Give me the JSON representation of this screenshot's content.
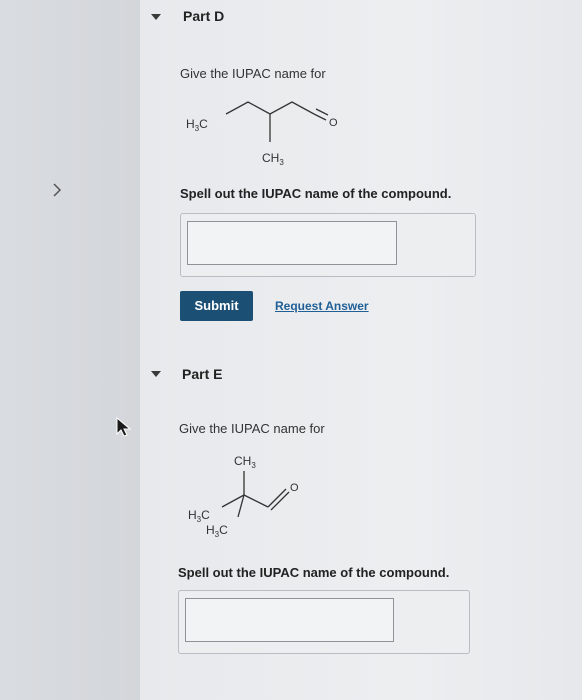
{
  "partD": {
    "title": "Part D",
    "prompt": "Give the IUPAC name for",
    "molecule": {
      "left_group": "H3C",
      "branch": "CH3",
      "oxygen": "O"
    },
    "instruction": "Spell out the IUPAC name of the compound.",
    "answer_value": "",
    "submit_label": "Submit",
    "request_label": "Request Answer"
  },
  "partE": {
    "title": "Part E",
    "prompt": "Give the IUPAC name for",
    "molecule": {
      "top_group": "CH3",
      "left_group_1": "H3C",
      "left_group_2": "H3C",
      "oxygen": "O"
    },
    "instruction": "Spell out the IUPAC name of the compound.",
    "answer_value": ""
  },
  "left_nav": {
    "arrow_icon": "chevron-right-icon"
  },
  "colors": {
    "submit_bg": "#1b4f74",
    "link": "#1f5f96"
  }
}
